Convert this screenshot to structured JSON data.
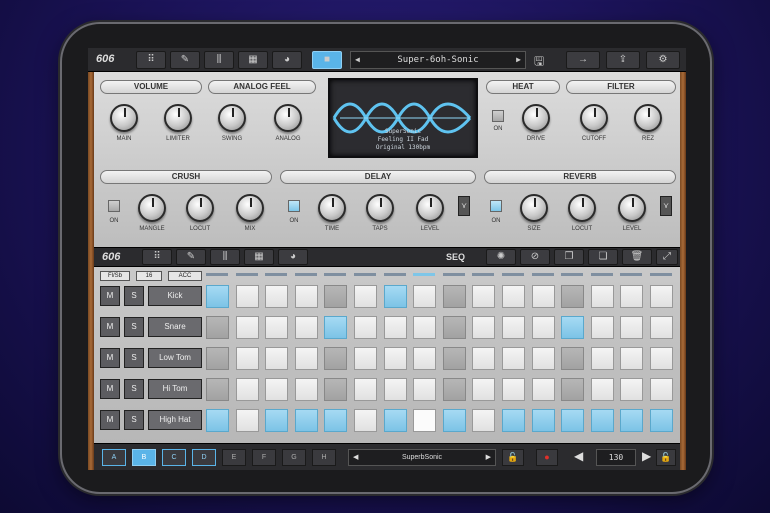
{
  "topbar": {
    "logo": "606",
    "preset": "Super-6oh-Sonic",
    "icons": [
      "steps-icon",
      "tool-icon",
      "mixer-icon",
      "grid-icon",
      "record-knob-icon",
      "stop-icon",
      "save-icon",
      "next-arrow-icon",
      "share-icon",
      "gear-icon"
    ]
  },
  "sections": {
    "volume": "VOLUME",
    "analog_feel": "ANALOG FEEL",
    "heat": "HEAT",
    "filter": "FILTER",
    "crush": "CRUSH",
    "delay": "DELAY",
    "reverb": "REVERB"
  },
  "knobs": {
    "main": "MAIN",
    "limiter": "LIMITER",
    "swing": "SWING",
    "analog": "ANALOG",
    "drive": "DRIVE",
    "cutoff": "CUTOFF",
    "rez": "REZ",
    "mangle": "MANGLE",
    "crush_locut": "LOCUT",
    "mix": "MIX",
    "time": "TIME",
    "taps": "TAPS",
    "delay_level": "LEVEL",
    "size": "SIZE",
    "reverb_locut": "LOCUT",
    "reverb_level": "LEVEL"
  },
  "on_label": "ON",
  "display": {
    "line1": "SuperSonic",
    "line2": "Feeling II Fad",
    "line3": "Original 130bpm"
  },
  "seqbar": {
    "logo": "606",
    "mode": "SEQ"
  },
  "seqopts": {
    "fl": "Fl/Sb",
    "len": "16",
    "acc": "ACC"
  },
  "track_buttons": {
    "mute": "M",
    "solo": "S"
  },
  "tracks": [
    {
      "name": "Kick",
      "steps": "bwwwgwbwgwwwgwww"
    },
    {
      "name": "Snare",
      "steps": "gwwwbwwwgwwwbwww"
    },
    {
      "name": "Low Tom",
      "steps": "gwwwgwwwgwwwgwww"
    },
    {
      "name": "Hi Tom",
      "steps": "gwwwgwwwgwwwgwww"
    },
    {
      "name": "High Hat",
      "steps": "bwbbbwbwbwbbbbbb"
    }
  ],
  "current_step": 7,
  "patterns": [
    "A",
    "B",
    "C",
    "D",
    "E",
    "F",
    "G",
    "H"
  ],
  "selected_pattern": "B",
  "bottom": {
    "preset": "SuperbSonic",
    "tempo": "130"
  },
  "colors": {
    "accent": "#5ab4e8",
    "step_on": "#7cc3e6",
    "wood": "#a86a38"
  }
}
